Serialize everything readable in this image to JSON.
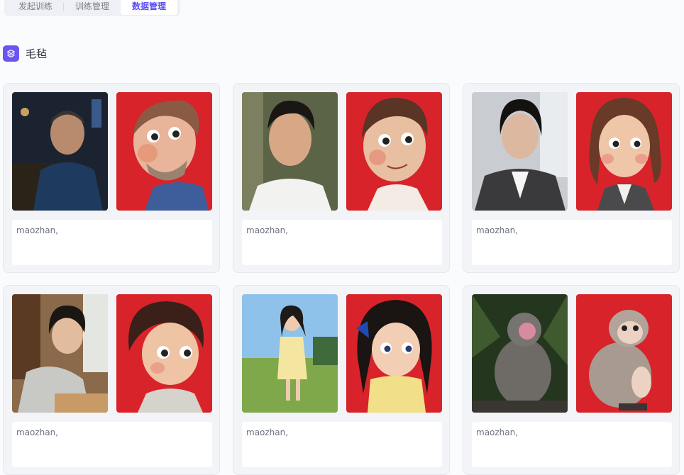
{
  "tabs": [
    {
      "label": "发起训练"
    },
    {
      "label": "训练管理"
    },
    {
      "label": "数据管理"
    }
  ],
  "section": {
    "title": "毛毡"
  },
  "cards": [
    {
      "caption": "maozhan,",
      "original_icon": "man-in-rain-photo",
      "felt_icon": "felt-man-figure"
    },
    {
      "caption": "maozhan,",
      "original_icon": "young-man-photo",
      "felt_icon": "felt-boy-figure"
    },
    {
      "caption": "maozhan,",
      "original_icon": "businesswoman-photo",
      "felt_icon": "felt-woman-figure"
    },
    {
      "caption": "maozhan,",
      "original_icon": "girl-reading-photo",
      "felt_icon": "felt-girl-figure"
    },
    {
      "caption": "maozhan,",
      "original_icon": "girl-in-meadow-photo",
      "felt_icon": "felt-girl-bow-figure"
    },
    {
      "caption": "maozhan,",
      "original_icon": "monkey-photo",
      "felt_icon": "felt-monkey-figure"
    }
  ],
  "colors": {
    "accent": "#6a55f2",
    "felt_background": "#d8232a"
  }
}
